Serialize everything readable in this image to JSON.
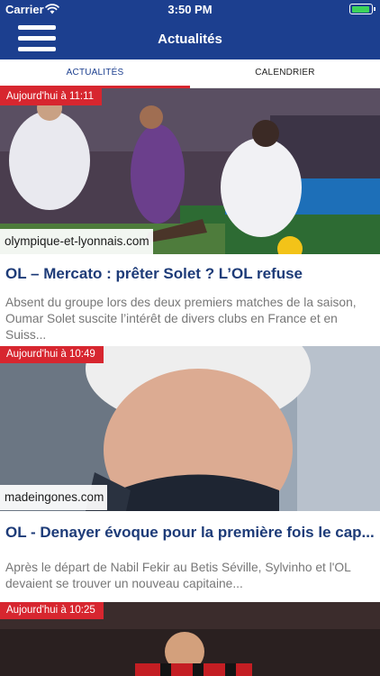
{
  "status_bar": {
    "carrier": "Carrier",
    "time": "3:50 PM",
    "battery_level": 0.95
  },
  "header": {
    "title": "Actualités",
    "menu_icon": "hamburger-menu-icon"
  },
  "tabs": [
    {
      "label": "ACTUALITÉS",
      "active": true
    },
    {
      "label": "CALENDRIER",
      "active": false
    }
  ],
  "articles": [
    {
      "time": "Aujourd'hui à 11:11",
      "source": "olympique-et-lyonnais.com",
      "title": "OL – Mercato : prêter Solet ? L’OL refuse",
      "summary": "Absent du groupe lors des deux premiers matches de la saison, Oumar Solet suscite l’intérêt de divers clubs en France et en Suiss..."
    },
    {
      "time": "Aujourd'hui à 10:49",
      "source": "madeingones.com",
      "title": "OL - Denayer évoque pour la première fois le cap...",
      "summary": "Après le départ de Nabil Fekir au Betis Séville, Sylvinho et l'OL devaient se trouver un nouveau capitaine..."
    },
    {
      "time": "Aujourd'hui à 10:25"
    }
  ],
  "colors": {
    "header_bg": "#1c3f8f",
    "accent_red": "#d7262f",
    "headline_blue": "#1d3b78"
  }
}
